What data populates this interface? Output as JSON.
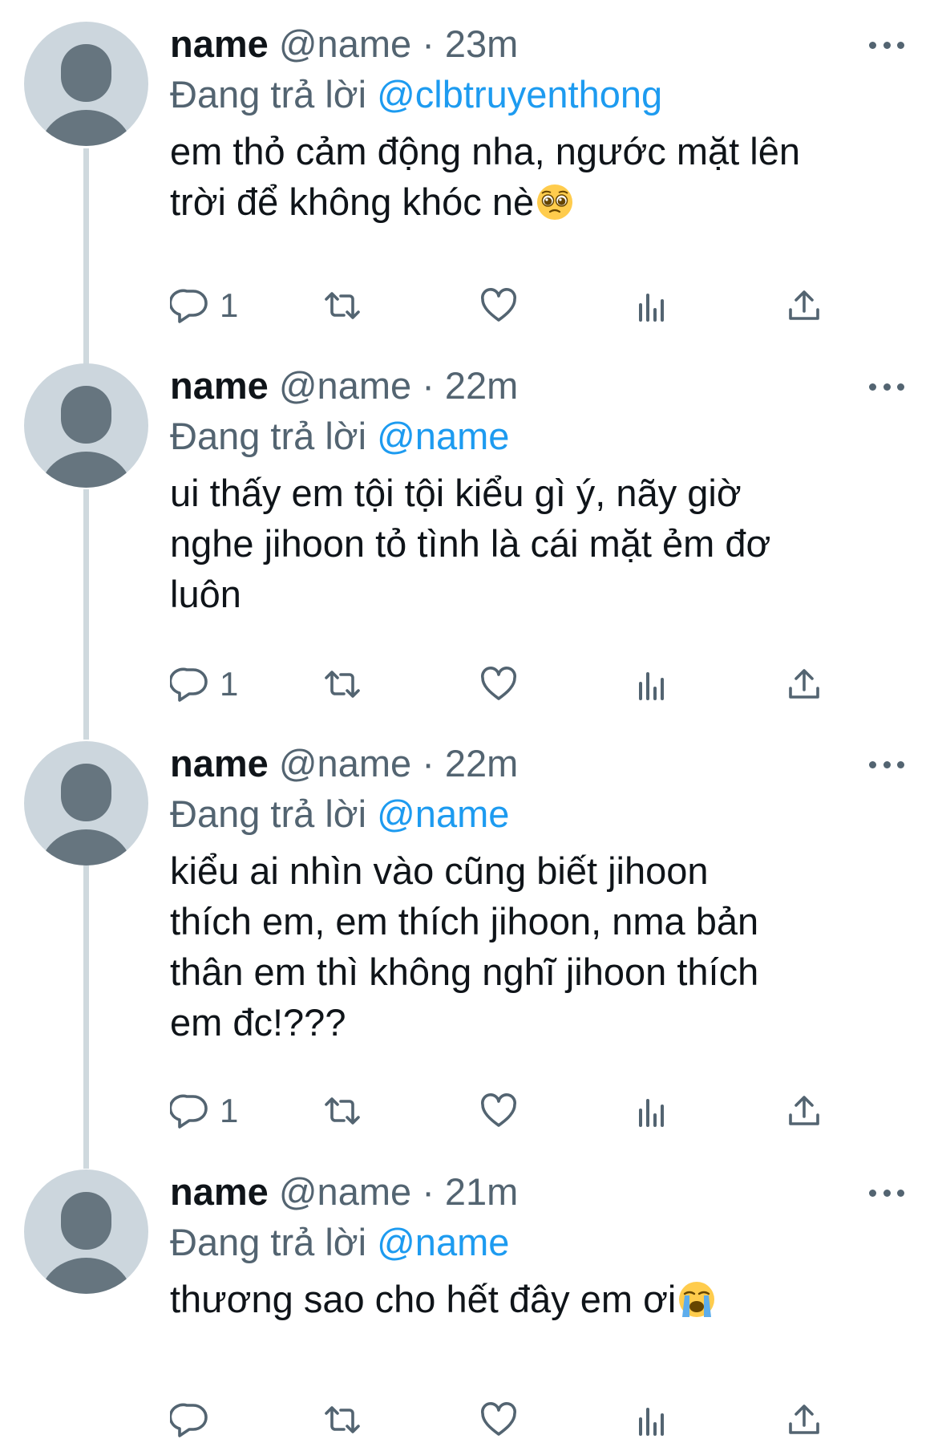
{
  "tweets": [
    {
      "name": "name",
      "handle": "@name",
      "separator": "·",
      "time": "23m",
      "reply_prefix": "Đang trả lời",
      "reply_to": "@clbtruyenthong",
      "text": "em thỏ cảm động nha, ngước mặt lên\ntrời để không khóc nè",
      "emoji": "pleading-face",
      "reply_count": "1"
    },
    {
      "name": "name",
      "handle": "@name",
      "separator": "·",
      "time": "22m",
      "reply_prefix": "Đang trả lời",
      "reply_to": "@name",
      "text": "ui thấy em tội tội kiểu gì ý, nãy giờ\nnghe jihoon tỏ tình là cái mặt ẻm đơ\nluôn",
      "emoji": "",
      "reply_count": "1"
    },
    {
      "name": "name",
      "handle": "@name",
      "separator": "·",
      "time": "22m",
      "reply_prefix": "Đang trả lời",
      "reply_to": "@name",
      "text": "kiểu ai nhìn vào cũng biết jihoon\nthích em, em thích jihoon, nma bản\nthân em thì không nghĩ jihoon thích\nem đc!???",
      "emoji": "",
      "reply_count": "1"
    },
    {
      "name": "name",
      "handle": "@name",
      "separator": "·",
      "time": "21m",
      "reply_prefix": "Đang trả lời",
      "reply_to": "@name",
      "text": "thương sao cho hết đây em ơi",
      "emoji": "loudly-crying-face",
      "reply_count": ""
    }
  ],
  "icons": {
    "reply": "speech-bubble-icon",
    "retweet": "retweet-icon",
    "like": "heart-icon",
    "views": "bar-chart-icon",
    "share": "share-upload-icon",
    "more": "ellipsis-icon",
    "avatar": "default-avatar-icon"
  },
  "colors": {
    "text": "#0f1419",
    "secondary": "#536471",
    "link": "#1d9bf0",
    "avatar_bg": "#ccd6dd",
    "avatar_fg": "#66757f",
    "thread_line": "#cfd9de"
  }
}
